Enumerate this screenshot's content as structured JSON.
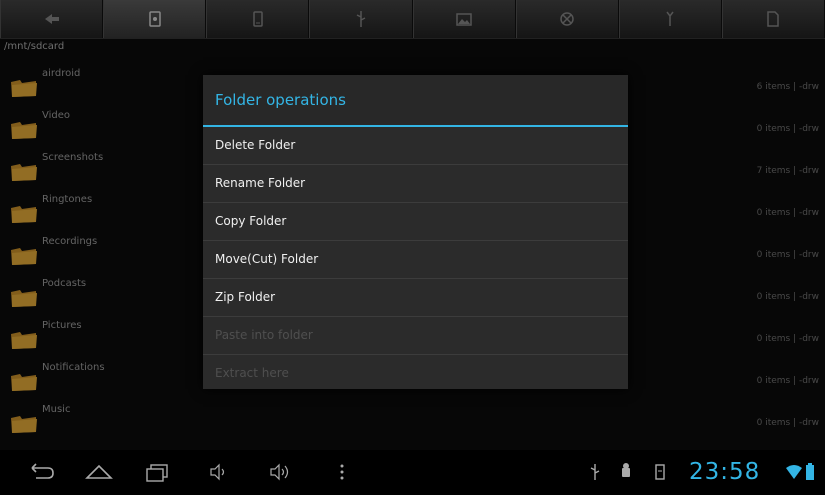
{
  "toolbar": {
    "icons": [
      "back-icon",
      "sdcard-icon",
      "phone-storage-icon",
      "usb-icon",
      "image-icon",
      "settings-icon",
      "tools-icon",
      "file-icon"
    ]
  },
  "path": "/mnt/sdcard",
  "files": [
    {
      "name": "airdroid",
      "info": "6 items | -drw"
    },
    {
      "name": "Video",
      "info": "0 items | -drw"
    },
    {
      "name": "Screenshots",
      "info": "7 items | -drw"
    },
    {
      "name": "Ringtones",
      "info": "0 items | -drw"
    },
    {
      "name": "Recordings",
      "info": "0 items | -drw"
    },
    {
      "name": "Podcasts",
      "info": "0 items | -drw"
    },
    {
      "name": "Pictures",
      "info": "0 items | -drw"
    },
    {
      "name": "Notifications",
      "info": "0 items | -drw"
    },
    {
      "name": "Music",
      "info": "0 items | -drw"
    }
  ],
  "dialog": {
    "title": "Folder operations",
    "items": [
      {
        "label": "Delete Folder",
        "enabled": true
      },
      {
        "label": "Rename Folder",
        "enabled": true
      },
      {
        "label": "Copy Folder",
        "enabled": true
      },
      {
        "label": "Move(Cut) Folder",
        "enabled": true
      },
      {
        "label": "Zip Folder",
        "enabled": true
      },
      {
        "label": "Paste into folder",
        "enabled": false
      },
      {
        "label": "Extract here",
        "enabled": false
      }
    ]
  },
  "statusbar": {
    "clock": "23:58",
    "accent": "#33b5e5"
  }
}
